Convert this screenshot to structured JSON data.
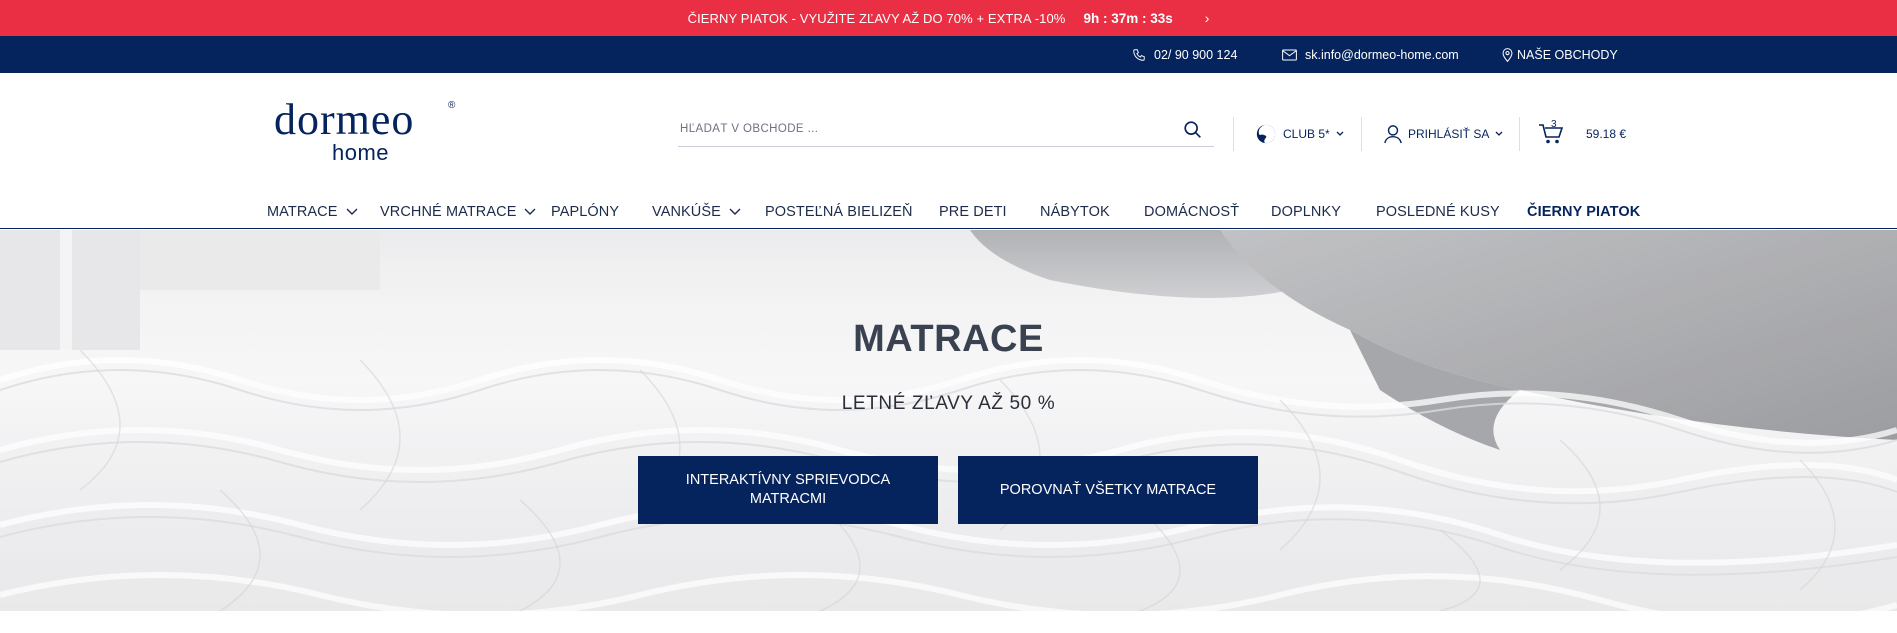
{
  "promo": {
    "text": "ČIERNY PIATOK - VYUŽITE ZĽAVY AŽ DO 70% + EXTRA -10%",
    "countdown": "9h : 37m : 33s",
    "arrow": "›"
  },
  "contact": {
    "phone": "02/ 90 900 124",
    "email": "sk.info@dormeo-home.com",
    "stores": "NAŠE OBCHODY",
    "icons": [
      "phone-icon",
      "mail-icon",
      "location-pin-icon"
    ]
  },
  "logo": {
    "brand": "DORMEO",
    "registered": "®",
    "sub": "home"
  },
  "search": {
    "placeholder": "HĽADAŤ V OBCHODE ..."
  },
  "header": {
    "club_label": "CLUB 5*",
    "login_label": "PRIHLÁSIŤ SA",
    "cart_count": "3",
    "cart_total": "59.18 €"
  },
  "nav": {
    "items": [
      {
        "label": "MATRACE",
        "has_dropdown": true
      },
      {
        "label": "VRCHNÉ MATRACE",
        "has_dropdown": true
      },
      {
        "label": "PAPLÓNY",
        "has_dropdown": false
      },
      {
        "label": "VANKÚŠE",
        "has_dropdown": true
      },
      {
        "label": "POSTEĽNÁ BIELIZEŇ",
        "has_dropdown": false
      },
      {
        "label": "PRE DETI",
        "has_dropdown": false
      },
      {
        "label": "NÁBYTOK",
        "has_dropdown": false
      },
      {
        "label": "DOMÁCNOSŤ",
        "has_dropdown": false
      },
      {
        "label": "DOPLNKY",
        "has_dropdown": false
      },
      {
        "label": "POSLEDNÉ KUSY",
        "has_dropdown": false
      },
      {
        "label": "ČIERNY PIATOK",
        "has_dropdown": false
      }
    ]
  },
  "hero": {
    "title": "MATRACE",
    "subtitle": "LETNÉ ZĽAVY AŽ 50 %",
    "buttons": [
      {
        "label": "INTERAKTÍVNY SPRIEVODCA MATRACMI"
      },
      {
        "label": "POROVNAŤ VŠETKY MATRACE"
      }
    ]
  },
  "colors": {
    "promo_red": "#ea2f44",
    "navy": "#05235c",
    "text": "#1c2b4a"
  }
}
